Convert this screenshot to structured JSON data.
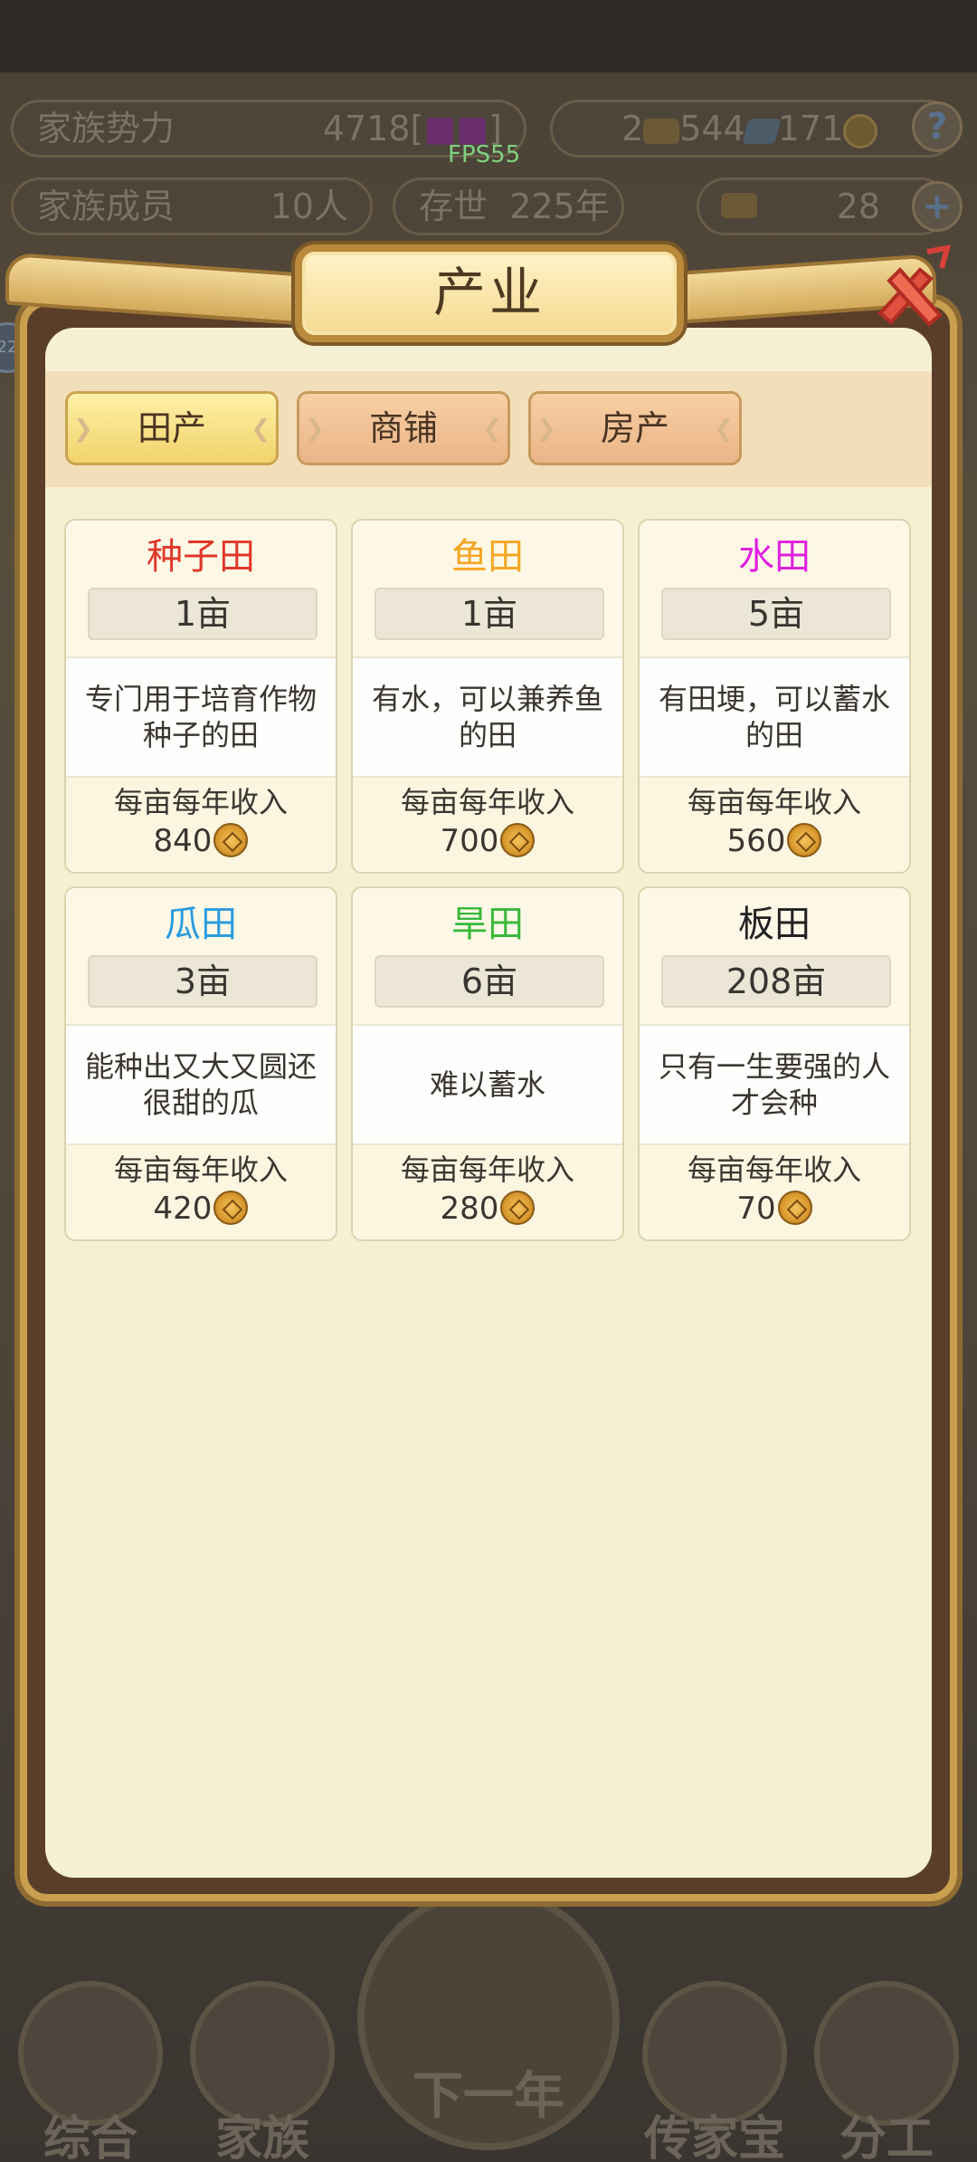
{
  "hud": {
    "power_label": "家族势力",
    "power_value": "4718",
    "power_rank_prefix": "[",
    "power_rank_text": "■■",
    "power_rank_suffix": "]",
    "gold_bars": "2",
    "silver": "544",
    "copper": "171",
    "members_label": "家族成员",
    "members_value": "10人",
    "age_label": "存世",
    "age_value": "225年",
    "ingot_value": "28",
    "help_glyph": "?",
    "plus_glyph": "+",
    "fps": "FPS55",
    "side_badge": "22"
  },
  "modal": {
    "title": "产业",
    "tabs": [
      {
        "label": "田产",
        "active": true
      },
      {
        "label": "商铺",
        "active": false
      },
      {
        "label": "房产",
        "active": false
      }
    ],
    "cards": [
      {
        "name": "种子田",
        "color": "#e0382a",
        "area": "1亩",
        "desc": "专门用于培育作物种子的田",
        "income_label": "每亩每年收入",
        "income": "840"
      },
      {
        "name": "鱼田",
        "color": "#f5a623",
        "area": "1亩",
        "desc": "有水，可以兼养鱼的田",
        "income_label": "每亩每年收入",
        "income": "700"
      },
      {
        "name": "水田",
        "color": "#e020e0",
        "area": "5亩",
        "desc": "有田埂，可以蓄水的田",
        "income_label": "每亩每年收入",
        "income": "560"
      },
      {
        "name": "瓜田",
        "color": "#2a9be0",
        "area": "3亩",
        "desc": "能种出又大又圆还很甜的瓜",
        "income_label": "每亩每年收入",
        "income": "420"
      },
      {
        "name": "旱田",
        "color": "#39b83a",
        "area": "6亩",
        "desc": "难以蓄水",
        "income_label": "每亩每年收入",
        "income": "280"
      },
      {
        "name": "板田",
        "color": "#222222",
        "area": "208亩",
        "desc": "只有一生要强的人才会种",
        "income_label": "每亩每年收入",
        "income": "70"
      }
    ]
  },
  "nav": {
    "items": [
      "综合",
      "家族",
      "下一年",
      "传家宝",
      "分工"
    ]
  }
}
